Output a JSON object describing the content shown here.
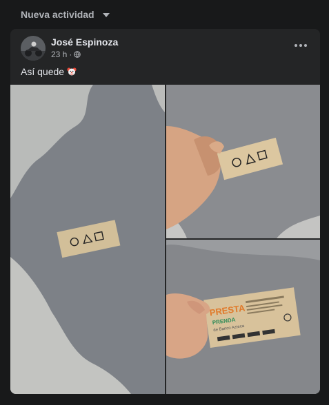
{
  "feed": {
    "filter_label": "Nueva actividad"
  },
  "post": {
    "author": "José Espinoza",
    "time": "23 h",
    "separator": "·",
    "text": "Así quede",
    "emoji": "clown-face-icon"
  },
  "photos": {
    "card_shapes": [
      "circle",
      "triangle",
      "square"
    ],
    "brand_line1": "PRESTA",
    "brand_line2": "PRENDA",
    "brand_line3": "de Banco Azteca"
  }
}
